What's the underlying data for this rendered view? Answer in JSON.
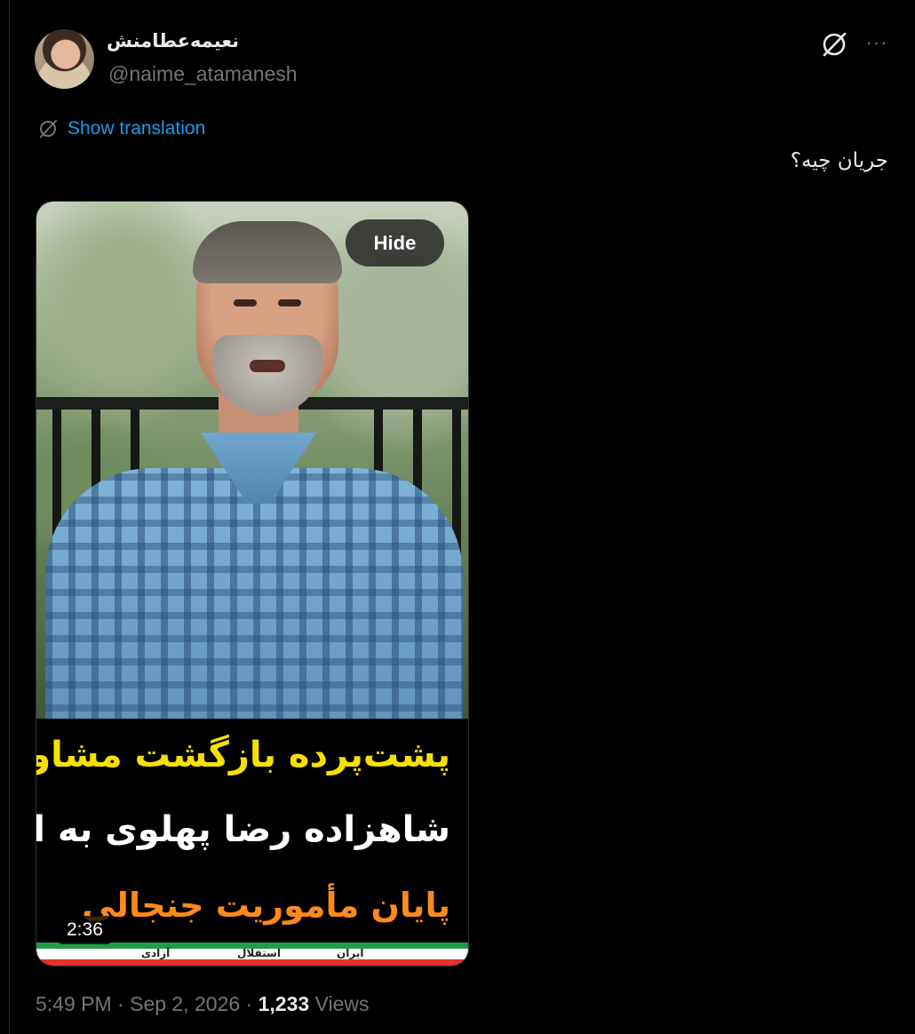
{
  "author": {
    "display_name": "نعیمه‌عطامنش",
    "handle": "@naime_atamanesh"
  },
  "header_icons": {
    "grok": "grok-icon",
    "more": "more-horizontal-icon",
    "more_glyph": "···"
  },
  "translation": {
    "icon": "grok-icon",
    "label": "Show translation"
  },
  "tweet": {
    "text": "جریان چیه؟"
  },
  "media": {
    "hide_label": "Hide",
    "duration": "2:36",
    "caption_line1": "پشت‌پرده بازگشت مشاور",
    "caption_line2": "شاهزاده رضا پهلوی به ایران!",
    "caption_line3": "پایان مأموریت جنجالی",
    "flag_words": [
      "ایران",
      "استقلال",
      "آزادی"
    ]
  },
  "meta": {
    "time": "5:49 PM",
    "separator1": " · ",
    "date": "Sep 2, 2026",
    "separator2": " · ",
    "views_count": "1,233",
    "views_label": " Views"
  },
  "colors": {
    "background": "#000000",
    "text": "#e7e9ea",
    "secondary": "#71767b",
    "link": "#1d9bf0",
    "caption_yellow": "#f6e000",
    "caption_orange": "#ff8a1c"
  }
}
